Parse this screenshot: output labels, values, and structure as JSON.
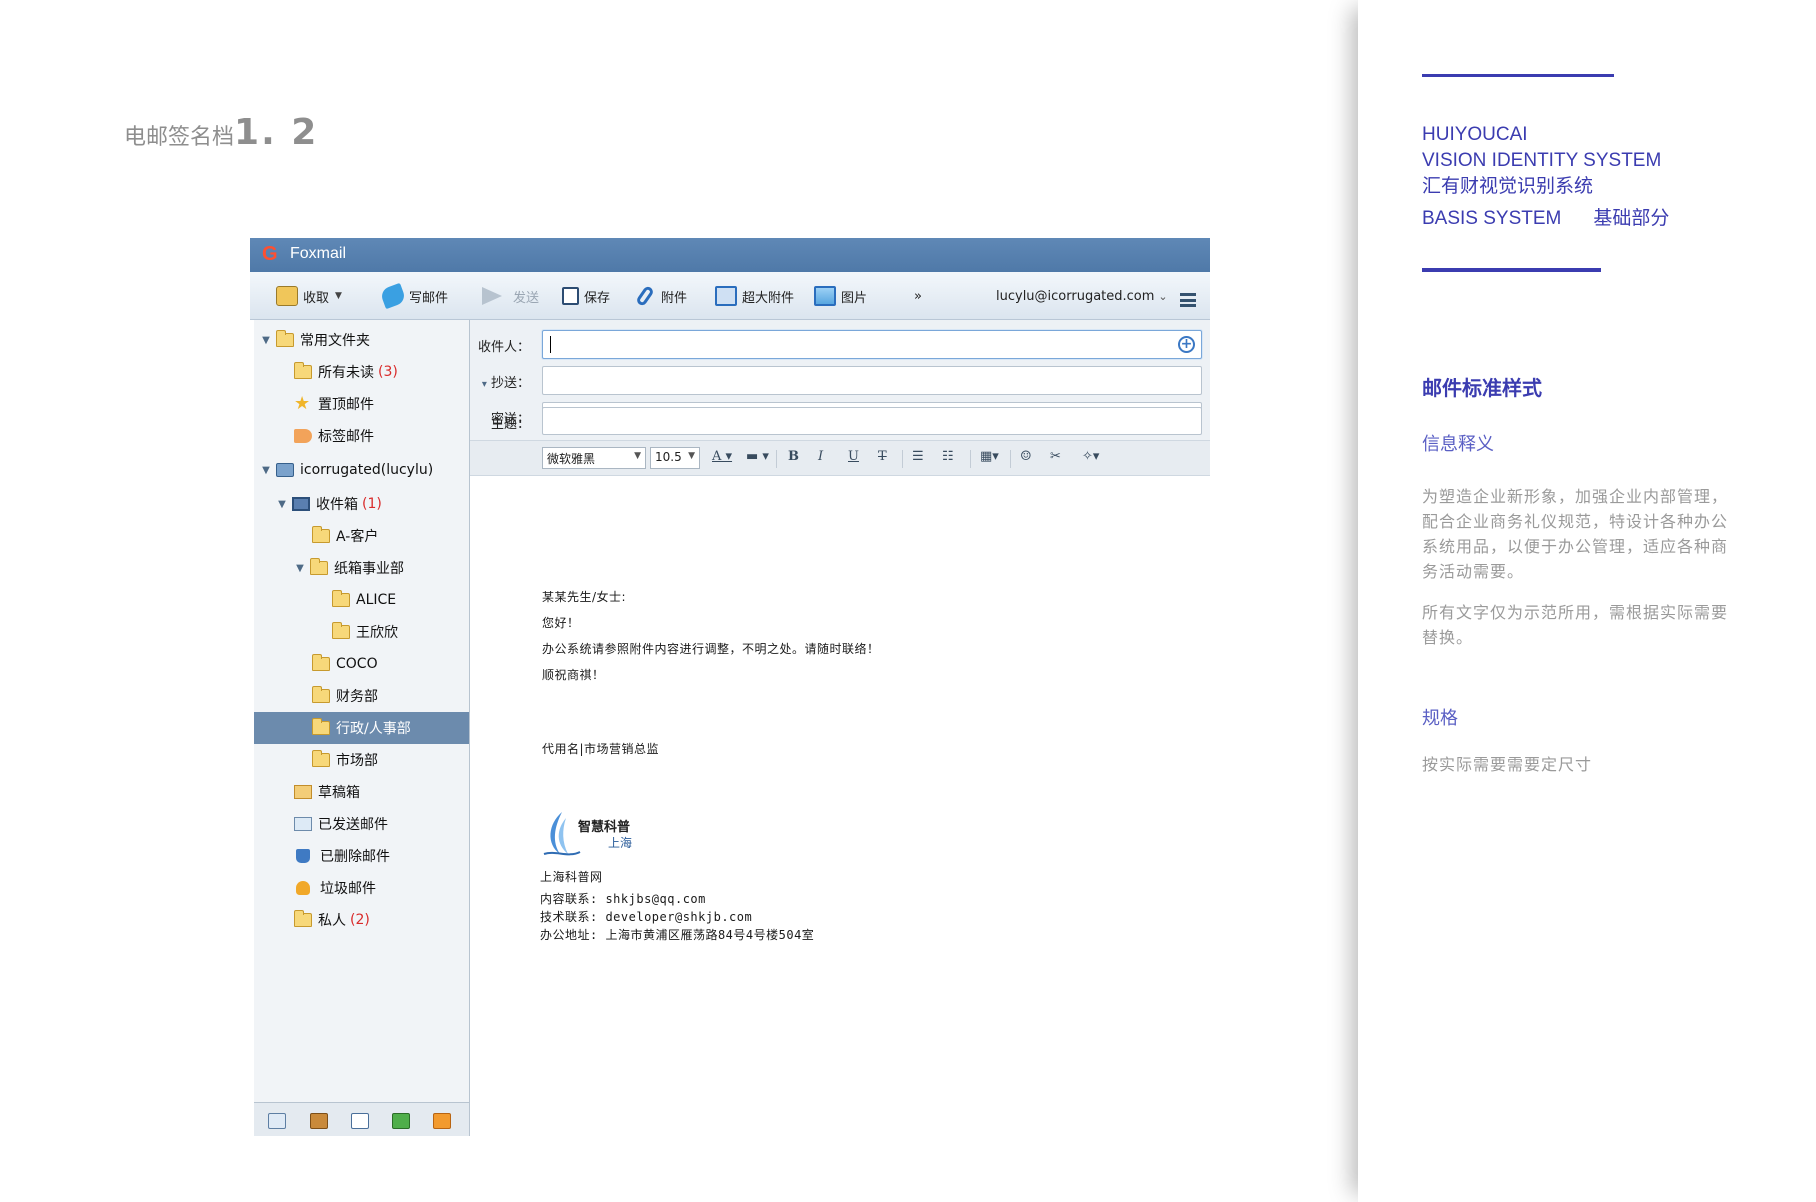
{
  "page": {
    "heading_text": "电邮签名档",
    "heading_number": "1. 2"
  },
  "right_panel": {
    "brand_line1": "HUIYOUCAI",
    "brand_line2": "VISION IDENTITY SYSTEM",
    "brand_line3": "汇有财视觉识别系统",
    "brand_line4_en": "BASIS SYSTEM",
    "brand_line4_cn": "基础部分",
    "section_title": "邮件标准样式",
    "info_heading": "信息释义",
    "info_paragraph1": "为塑造企业新形象，加强企业内部管理，配合企业商务礼仪规范，特设计各种办公系统用品，以便于办公管理，适应各种商务活动需要。",
    "info_paragraph2": "所有文字仅为示范所用，需根据实际需要替换。",
    "spec_heading": "规格",
    "spec_text": "按实际需要需要定尺寸",
    "accent_color": "#3b3cb0"
  },
  "window": {
    "title": "Foxmail",
    "logo_glyph": "G"
  },
  "toolbar": {
    "receive_label": "收取",
    "write_label": "写邮件",
    "send_label": "发送",
    "save_label": "保存",
    "attach_label": "附件",
    "big_attach_label": "超大附件",
    "image_label": "图片",
    "more_label": "»",
    "account_label": "lucylu@icorrugated.com",
    "account_caret": "⌄"
  },
  "sidebar": {
    "items": [
      {
        "label": "常用文件夹",
        "count": ""
      },
      {
        "label": "所有未读",
        "count": "(3)"
      },
      {
        "label": "置顶邮件",
        "count": ""
      },
      {
        "label": "标签邮件",
        "count": ""
      },
      {
        "label": "icorrugated(lucylu)",
        "count": ""
      },
      {
        "label": "收件箱",
        "count": "(1)"
      },
      {
        "label": "A-客户",
        "count": ""
      },
      {
        "label": "纸箱事业部",
        "count": ""
      },
      {
        "label": "ALICE",
        "count": ""
      },
      {
        "label": "王欣欣",
        "count": ""
      },
      {
        "label": "COCO",
        "count": ""
      },
      {
        "label": "财务部",
        "count": ""
      },
      {
        "label": "行政/人事部",
        "count": ""
      },
      {
        "label": "市场部",
        "count": ""
      },
      {
        "label": "草稿箱",
        "count": ""
      },
      {
        "label": "已发送邮件",
        "count": ""
      },
      {
        "label": "已删除邮件",
        "count": ""
      },
      {
        "label": "垃圾邮件",
        "count": ""
      },
      {
        "label": "私人",
        "count": "(2)"
      }
    ],
    "selected": "行政/人事部"
  },
  "compose": {
    "to_label": "收件人：",
    "cc_label": "抄送：",
    "cc_toggle": "▾",
    "bcc_label": "密送：",
    "subject_label": "主题：",
    "to_value": "",
    "cc_value": "",
    "bcc_value": "",
    "subject_value": "",
    "add_recipient_glyph": "+"
  },
  "format_bar": {
    "font_family": "微软雅黑",
    "font_size": "10.5",
    "bold": "B",
    "italic": "I",
    "underline": "U",
    "strike": "T"
  },
  "mail_body": {
    "greeting": "某某先生/女士:",
    "hello": "您好！",
    "message": "办公系统请参照附件内容进行调整，不明之处。请随时联络！",
    "closing": "顺祝商祺！",
    "signature_name": "代用名|市场营销总监",
    "logo_text_top": "智慧科普",
    "logo_text_bottom": "上海",
    "org_name": "上海科普网",
    "contact_content": "内容联系: shkjbs@qq.com",
    "contact_tech": "技术联系: developer@shkjb.com",
    "contact_address": "办公地址: 上海市黄浦区雁荡路84号4号楼504室"
  }
}
